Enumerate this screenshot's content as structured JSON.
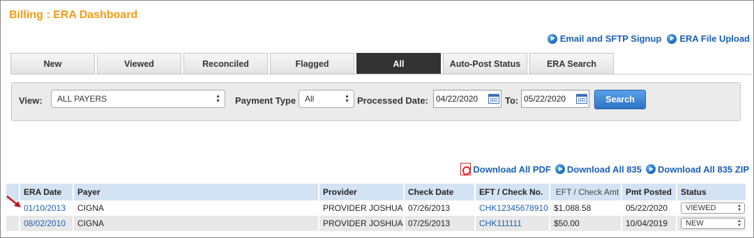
{
  "page": {
    "title": "Billing : ERA Dashboard"
  },
  "top_links": [
    {
      "label": "Email and SFTP Signup",
      "icon": "play-circle-icon"
    },
    {
      "label": "ERA File Upload",
      "icon": "play-circle-icon"
    }
  ],
  "tabs": [
    {
      "label": "New",
      "active": false
    },
    {
      "label": "Viewed",
      "active": false
    },
    {
      "label": "Reconciled",
      "active": false
    },
    {
      "label": "Flagged",
      "active": false
    },
    {
      "label": "All",
      "active": true
    },
    {
      "label": "Auto-Post Status",
      "active": false
    },
    {
      "label": "ERA Search",
      "active": false
    }
  ],
  "filters": {
    "view_label": "View:",
    "view_value": "ALL PAYERS",
    "payment_type_label": "Payment Type",
    "payment_type_value": "All",
    "processed_date_label": "Processed Date:",
    "from_date": "04/22/2020",
    "to_label": "To:",
    "to_date": "05/22/2020",
    "search_label": "Search"
  },
  "downloads": [
    {
      "label": "Download All PDF",
      "icon": "pdf-icon"
    },
    {
      "label": "Download All 835",
      "icon": "play-circle-icon"
    },
    {
      "label": "Download All 835 ZIP",
      "icon": "play-circle-icon"
    }
  ],
  "table": {
    "headers": [
      "ERA Date",
      "Payer",
      "Provider",
      "Check Date",
      "EFT / Check No.",
      "EFT / Check Amt",
      "Pmt Posted",
      "Status"
    ],
    "rows": [
      {
        "era_date": "01/10/2013",
        "payer": "CIGNA",
        "provider": "PROVIDER JOSHUA",
        "check_date": "07/26/2013",
        "check_no": "CHK12345678910",
        "amount": "$1,088.58",
        "pmt_posted": "05/22/2020",
        "status": "VIEWED"
      },
      {
        "era_date": "08/02/2010",
        "payer": "CIGNA",
        "provider": "PROVIDER JOSHUA",
        "check_date": "07/25/2013",
        "check_no": "CHK111111",
        "amount": "$50.00",
        "pmt_posted": "10/04/2019",
        "status": "NEW"
      }
    ]
  },
  "colors": {
    "title": "#f39c12",
    "link": "#1a5fb4",
    "active_tab": "#333333",
    "header_bg": "#d4e3f3",
    "search_button": "#2d73c6",
    "annotation_arrow": "#c0141c"
  }
}
